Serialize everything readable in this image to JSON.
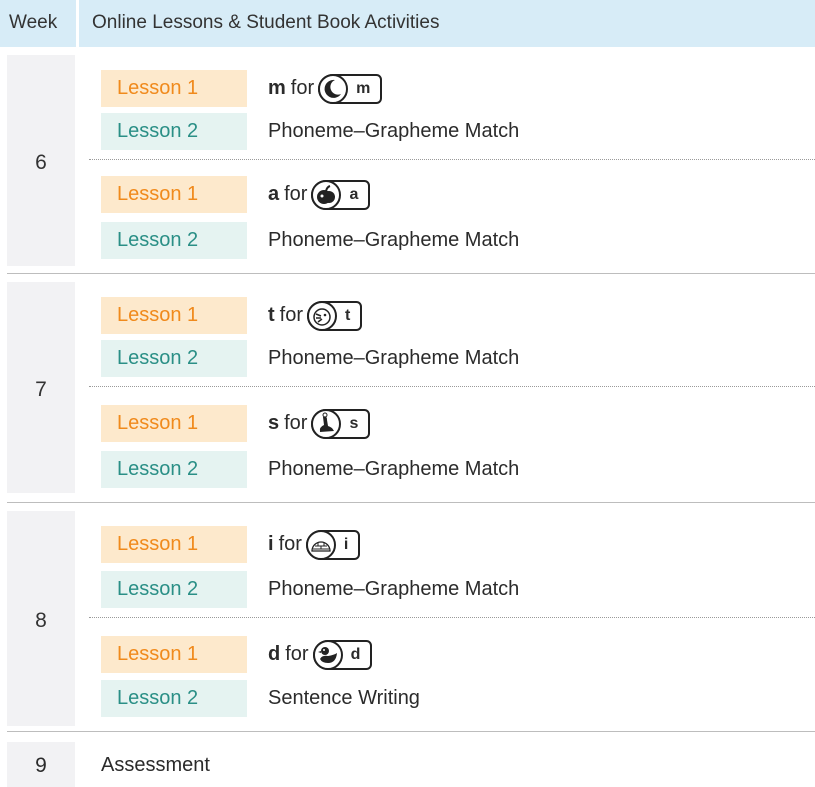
{
  "header": {
    "week": "Week",
    "activities": "Online Lessons & Student Book Activities"
  },
  "weeks": [
    {
      "number": "6",
      "lessons": [
        {
          "badge": "Lesson 1",
          "letter": "m",
          "for": "for",
          "card": "m",
          "icon": "moon-icon"
        },
        {
          "badge": "Lesson 2",
          "text": "Phoneme–Grapheme Match"
        },
        {
          "badge": "Lesson 1",
          "letter": "a",
          "for": "for",
          "card": "a",
          "icon": "apple-icon"
        },
        {
          "badge": "Lesson 2",
          "text": "Phoneme–Grapheme Match"
        }
      ]
    },
    {
      "number": "7",
      "lessons": [
        {
          "badge": "Lesson 1",
          "letter": "t",
          "for": "for",
          "card": "t",
          "icon": "tiger-icon"
        },
        {
          "badge": "Lesson 2",
          "text": "Phoneme–Grapheme Match"
        },
        {
          "badge": "Lesson 1",
          "letter": "s",
          "for": "for",
          "card": "s",
          "icon": "seal-icon"
        },
        {
          "badge": "Lesson 2",
          "text": "Phoneme–Grapheme Match"
        }
      ]
    },
    {
      "number": "8",
      "lessons": [
        {
          "badge": "Lesson 1",
          "letter": "i",
          "for": "for",
          "card": "i",
          "icon": "igloo-icon"
        },
        {
          "badge": "Lesson 2",
          "text": "Phoneme–Grapheme Match"
        },
        {
          "badge": "Lesson 1",
          "letter": "d",
          "for": "for",
          "card": "d",
          "icon": "duck-icon"
        },
        {
          "badge": "Lesson 2",
          "text": "Sentence Writing"
        }
      ]
    }
  ],
  "assessment": {
    "number": "9",
    "label": "Assessment"
  },
  "colors": {
    "header_bg": "#d7ecf7",
    "lesson1_bg": "#fde9cc",
    "lesson1_text": "#f08a1c",
    "lesson2_bg": "#e5f3f1",
    "lesson2_text": "#2a8f86",
    "week_bg": "#f2f2f4"
  }
}
